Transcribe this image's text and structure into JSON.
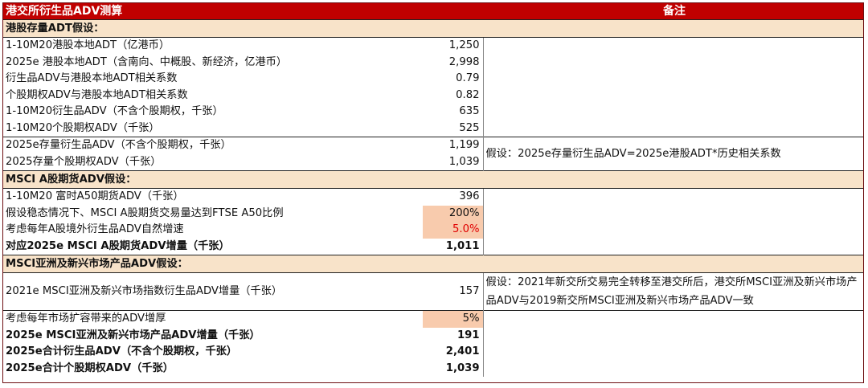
{
  "header": {
    "title": "港交所衍生品ADV测算",
    "note_header": "备注"
  },
  "sections": [
    {
      "title": "港股存量ADT假设：",
      "rows": [
        {
          "label": "1-10M20港股本地ADT（亿港币）",
          "value": "1,250",
          "note": ""
        },
        {
          "label": "2025e 港股本地ADT（含南向、中概股、新经济，亿港币）",
          "value": "2,998",
          "note": ""
        },
        {
          "label": "衍生品ADV与港股本地ADT相关系数",
          "value": "0.79",
          "note": ""
        },
        {
          "label": "个股期权ADV与港股本地ADT相关系数",
          "value": "0.82",
          "note": ""
        },
        {
          "label": "1-10M20衍生品ADV（不含个股期权，千张）",
          "value": "635",
          "note": ""
        },
        {
          "label": "1-10M20个股期权ADV（千张）",
          "value": "525",
          "note": ""
        },
        {
          "label": "2025e存量衍生品ADV（不含个股期权，千张）",
          "value": "1,199",
          "note": "假设：2025e存量衍生品ADV=2025e港股ADT*历史相关系数"
        },
        {
          "label": "2025存量个股期权ADV（千张）",
          "value": "1,039",
          "note": ""
        }
      ]
    },
    {
      "title": "MSCI A股期货ADV假设：",
      "rows": [
        {
          "label": "1-10M20 富时A50期货ADV（千张）",
          "value": "396",
          "note": ""
        },
        {
          "label": "假设稳态情况下、MSCI A股期货交易量达到FTSE A50比例",
          "value": "200%",
          "note": ""
        },
        {
          "label": "考虑每年A股境外衍生品ADV自然增速",
          "value": "5.0%",
          "note": ""
        },
        {
          "label": "对应2025e MSCI A股期货ADV增量（千张）",
          "value": "1,011",
          "note": ""
        }
      ]
    },
    {
      "title": "MSCI亚洲及新兴市场产品ADV假设：",
      "rows": [
        {
          "label": "2021e MSCI亚洲及新兴市场指数衍生品ADV增量（千张）",
          "value": "157",
          "note": "假设：2021年新交所交易完全转移至港交所后，港交所MSCI亚洲及新兴市场产品ADV与2019新交所MSCI亚洲及新兴市场产品ADV一致"
        },
        {
          "label": "考虑每年市场扩容带来的ADV增厚",
          "value": "5%",
          "note": ""
        },
        {
          "label": "2025e MSCI亚洲及新兴市场产品ADV增量（千张）",
          "value": "191",
          "note": ""
        },
        {
          "label": "2025e合计衍生品ADV（不含个股期权，千张）",
          "value": "2,401",
          "note": ""
        },
        {
          "label": "2025e合计个股期权ADV（千张）",
          "value": "1,039",
          "note": ""
        }
      ]
    }
  ],
  "colors": {
    "header_bg": "#c00000",
    "section_bg": "#f8e3c9",
    "highlight_bg": "#f8cbad",
    "highlight_text": "#e00000"
  }
}
